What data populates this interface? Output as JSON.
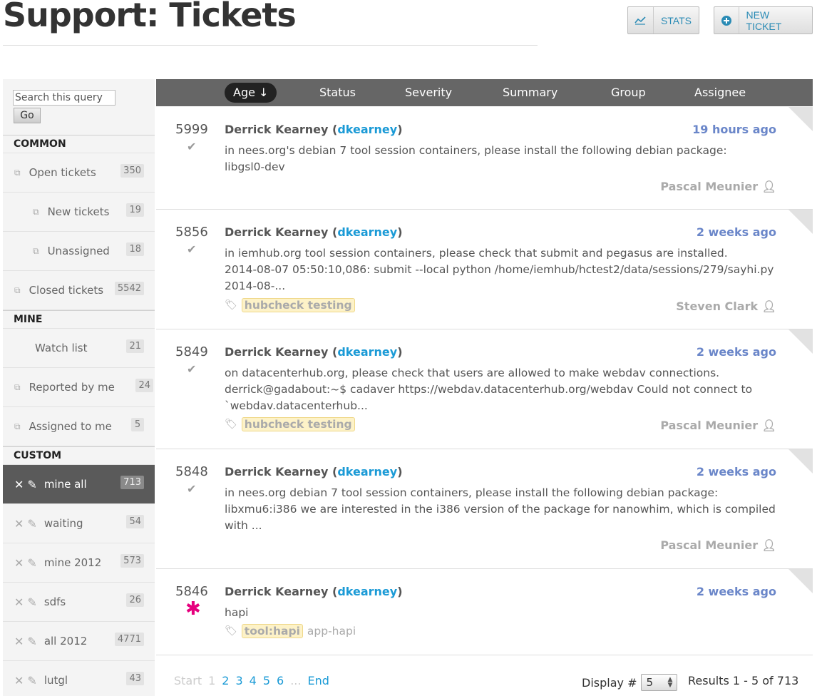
{
  "header": {
    "title": "Support: Tickets",
    "stats_label": "STATS",
    "new_ticket_label": "NEW TICKET"
  },
  "sidebar": {
    "search_placeholder": "Search this query",
    "go_label": "Go",
    "sections": {
      "common": "COMMON",
      "mine": "MINE",
      "custom": "CUSTOM"
    },
    "common": [
      {
        "label": "Open tickets",
        "count": "350"
      },
      {
        "label": "New tickets",
        "count": "19"
      },
      {
        "label": "Unassigned",
        "count": "18"
      },
      {
        "label": "Closed tickets",
        "count": "5542"
      }
    ],
    "mine": [
      {
        "label": "Watch list",
        "count": "21"
      },
      {
        "label": "Reported by me",
        "count": "24"
      },
      {
        "label": "Assigned to me",
        "count": "5"
      }
    ],
    "custom": [
      {
        "label": "mine all",
        "count": "713"
      },
      {
        "label": "waiting",
        "count": "54"
      },
      {
        "label": "mine 2012",
        "count": "573"
      },
      {
        "label": "sdfs",
        "count": "26"
      },
      {
        "label": "all 2012",
        "count": "4771"
      },
      {
        "label": "lutgl",
        "count": "43"
      }
    ]
  },
  "columns": [
    "Age",
    "Status",
    "Severity",
    "Summary",
    "Group",
    "Assignee"
  ],
  "tickets": [
    {
      "id": "5999",
      "reporter": "Derrick Kearney",
      "username": "dkearney",
      "age": "19 hours ago",
      "summary_lines": [
        "in nees.org's debian 7 tool session containers, please install the following debian package:",
        "libgsl0-dev"
      ],
      "tags": [],
      "owner": "Pascal Meunier"
    },
    {
      "id": "5856",
      "reporter": "Derrick Kearney",
      "username": "dkearney",
      "age": "2 weeks ago",
      "summary_lines": [
        "in iemhub.org tool session containers, please check that submit and pegasus are installed.",
        "2014-08-07 05:50:10,086: submit --local python /home/iemhub/hctest2/data/sessions/279/sayhi.py",
        "2014-08-..."
      ],
      "tags": [
        "hubcheck testing"
      ],
      "owner": "Steven Clark"
    },
    {
      "id": "5849",
      "reporter": "Derrick Kearney",
      "username": "dkearney",
      "age": "2 weeks ago",
      "summary_lines": [
        "on datacenterhub.org, please check that users are allowed to make webdav connections.",
        "derrick@gadabout:~$ cadaver https://webdav.datacenterhub.org/webdav Could not connect to",
        "`webdav.datacenterhub..."
      ],
      "tags": [
        "hubcheck testing"
      ],
      "owner": "Pascal Meunier"
    },
    {
      "id": "5848",
      "reporter": "Derrick Kearney",
      "username": "dkearney",
      "age": "2 weeks ago",
      "summary_lines": [
        "in nees.org debian 7 tool session containers, please install the following debian package:",
        "libxmu6:i386 we are interested in the i386 version of the package for nanowhim, which is compiled",
        "with ..."
      ],
      "tags": [],
      "owner": "Pascal Meunier"
    },
    {
      "id": "5846",
      "reporter": "Derrick Kearney",
      "username": "dkearney",
      "age": "2 weeks ago",
      "summary_lines": [
        "hapi"
      ],
      "tags": [
        "tool:hapi"
      ],
      "plain_tag": "app-hapi",
      "owner": ""
    }
  ],
  "pager": {
    "start": "Start",
    "pages": [
      "1",
      "2",
      "3",
      "4",
      "5",
      "6"
    ],
    "ellipsis": "...",
    "end": "End",
    "display_label": "Display #",
    "display_value": "5",
    "results": "Results 1 - 5 of 713"
  },
  "colors": {
    "accent": "#1a9ad6",
    "age": "#6a86c9",
    "header_bg": "#666666",
    "active_nav": "#5a5a5a",
    "new_status": "#e6007e"
  }
}
